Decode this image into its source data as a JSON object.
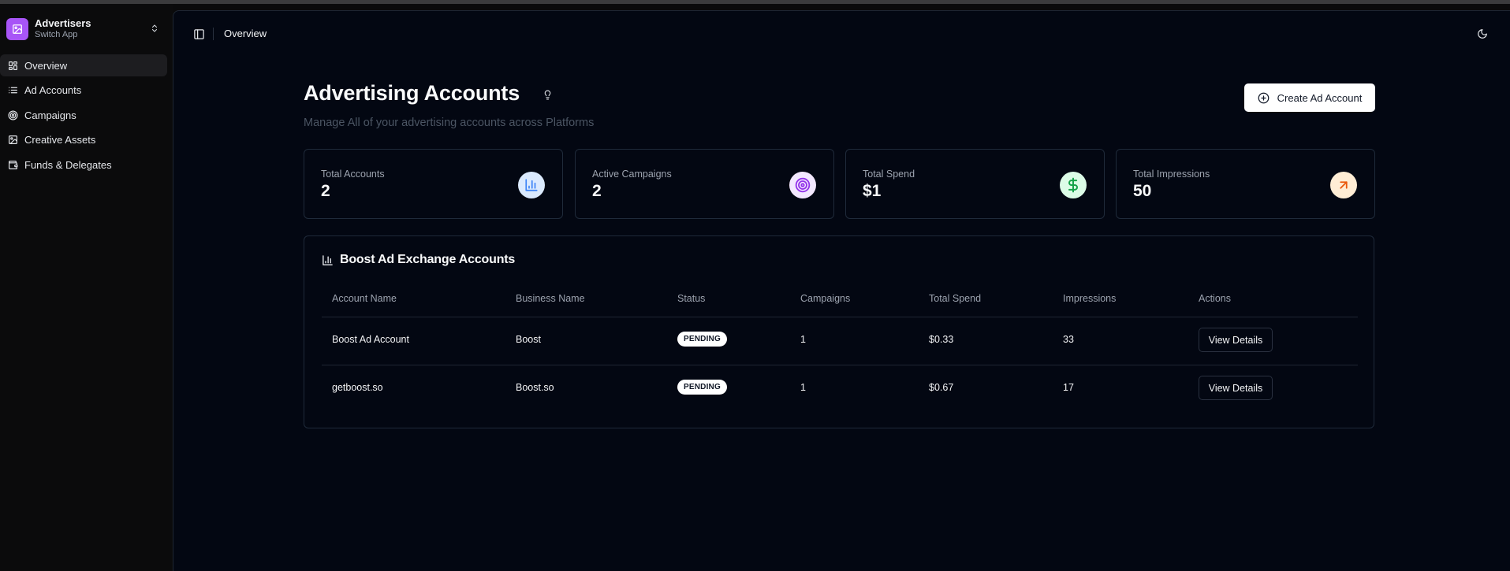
{
  "app": {
    "title": "Advertisers",
    "subtitle": "Switch App"
  },
  "sidebar": {
    "items": [
      {
        "label": "Overview",
        "icon": "layout-grid-icon",
        "active": true
      },
      {
        "label": "Ad Accounts",
        "icon": "list-icon",
        "active": false
      },
      {
        "label": "Campaigns",
        "icon": "target-icon",
        "active": false
      },
      {
        "label": "Creative Assets",
        "icon": "image-icon",
        "active": false
      },
      {
        "label": "Funds & Delegates",
        "icon": "wallet-icon",
        "active": false
      }
    ]
  },
  "header": {
    "breadcrumb": "Overview"
  },
  "page": {
    "title": "Advertising Accounts",
    "subtitle": "Manage All of your advertising accounts across Platforms",
    "create_button": "Create Ad Account"
  },
  "stats": [
    {
      "label": "Total Accounts",
      "value": "2",
      "icon": "bar-chart-icon",
      "color": "#3b82f6",
      "bg": "#dbeafe"
    },
    {
      "label": "Active Campaigns",
      "value": "2",
      "icon": "target-icon",
      "color": "#9333ea",
      "bg": "#f3e8ff"
    },
    {
      "label": "Total Spend",
      "value": "$1",
      "icon": "dollar-icon",
      "color": "#16a34a",
      "bg": "#dcfce7"
    },
    {
      "label": "Total Impressions",
      "value": "50",
      "icon": "arrow-up-right-icon",
      "color": "#ea580c",
      "bg": "#ffedd5"
    }
  ],
  "table": {
    "title": "Boost Ad Exchange Accounts",
    "columns": [
      "Account Name",
      "Business Name",
      "Status",
      "Campaigns",
      "Total Spend",
      "Impressions",
      "Actions"
    ],
    "rows": [
      {
        "account": "Boost Ad Account",
        "business": "Boost",
        "status": "PENDING",
        "campaigns": "1",
        "spend": "$0.33",
        "impressions": "33",
        "action": "View Details"
      },
      {
        "account": "getboost.so",
        "business": "Boost.so",
        "status": "PENDING",
        "campaigns": "1",
        "spend": "$0.67",
        "impressions": "17",
        "action": "View Details"
      }
    ]
  },
  "colors": {
    "accent": "#a855f7",
    "background": "#030712",
    "sidebar": "#0b0b0c"
  }
}
